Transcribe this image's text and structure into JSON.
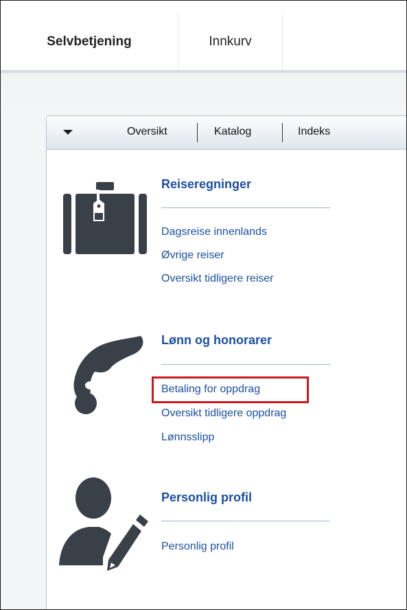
{
  "top_tabs": {
    "selvbetjening": "Selvbetjening",
    "innkurv": "Innkurv"
  },
  "panel_nav": {
    "oversikt": "Oversikt",
    "katalog": "Katalog",
    "indeks": "Indeks"
  },
  "sections": {
    "reiseregninger": {
      "title": "Reiseregninger",
      "links": [
        "Dagsreise innenlands",
        "Øvrige reiser",
        "Oversikt tidligere reiser"
      ]
    },
    "lonn": {
      "title": "Lønn og honorarer",
      "links": [
        "Betaling for oppdrag",
        "Oversikt tidligere oppdrag",
        "Lønnsslipp"
      ]
    },
    "profil": {
      "title": "Personlig profil",
      "links": [
        "Personlig profil"
      ]
    }
  },
  "icons": {
    "reiseregninger": "suitcase-icon",
    "lonn": "hand-coin-icon",
    "profil": "person-pencil-icon"
  },
  "colors": {
    "link": "#1c4fa3",
    "highlight": "#c8191e",
    "icon": "#3a4048"
  }
}
